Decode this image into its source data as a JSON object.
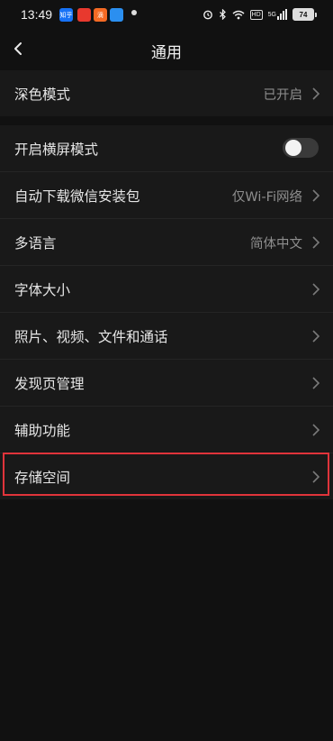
{
  "status_bar": {
    "time": "13:49",
    "apps": [
      {
        "icon": "zhihu-app-icon",
        "label": "知乎",
        "color": "#1772f6"
      },
      {
        "icon": "red-app-icon",
        "label": "",
        "color": "#e8392e"
      },
      {
        "icon": "orange-app-icon",
        "label": "滴",
        "color": "#f56a24"
      },
      {
        "icon": "blue-app-icon",
        "label": "",
        "color": "#2b8ff0"
      }
    ],
    "signal_label": "5G",
    "hd_label": "HD",
    "battery": "74"
  },
  "header": {
    "title": "通用"
  },
  "sections": {
    "dark_mode": {
      "label": "深色模式",
      "value": "已开启"
    },
    "landscape": {
      "label": "开启横屏模式",
      "enabled": false
    },
    "auto_download": {
      "label": "自动下载微信安装包",
      "value": "仅Wi-Fi网络"
    },
    "language": {
      "label": "多语言",
      "value": "简体中文"
    },
    "font_size": {
      "label": "字体大小"
    },
    "media": {
      "label": "照片、视频、文件和通话"
    },
    "discover": {
      "label": "发现页管理"
    },
    "accessibility": {
      "label": "辅助功能"
    },
    "storage": {
      "label": "存储空间"
    }
  },
  "colors": {
    "background": "#111111",
    "row_background": "#191919",
    "highlight": "#e0343b"
  }
}
